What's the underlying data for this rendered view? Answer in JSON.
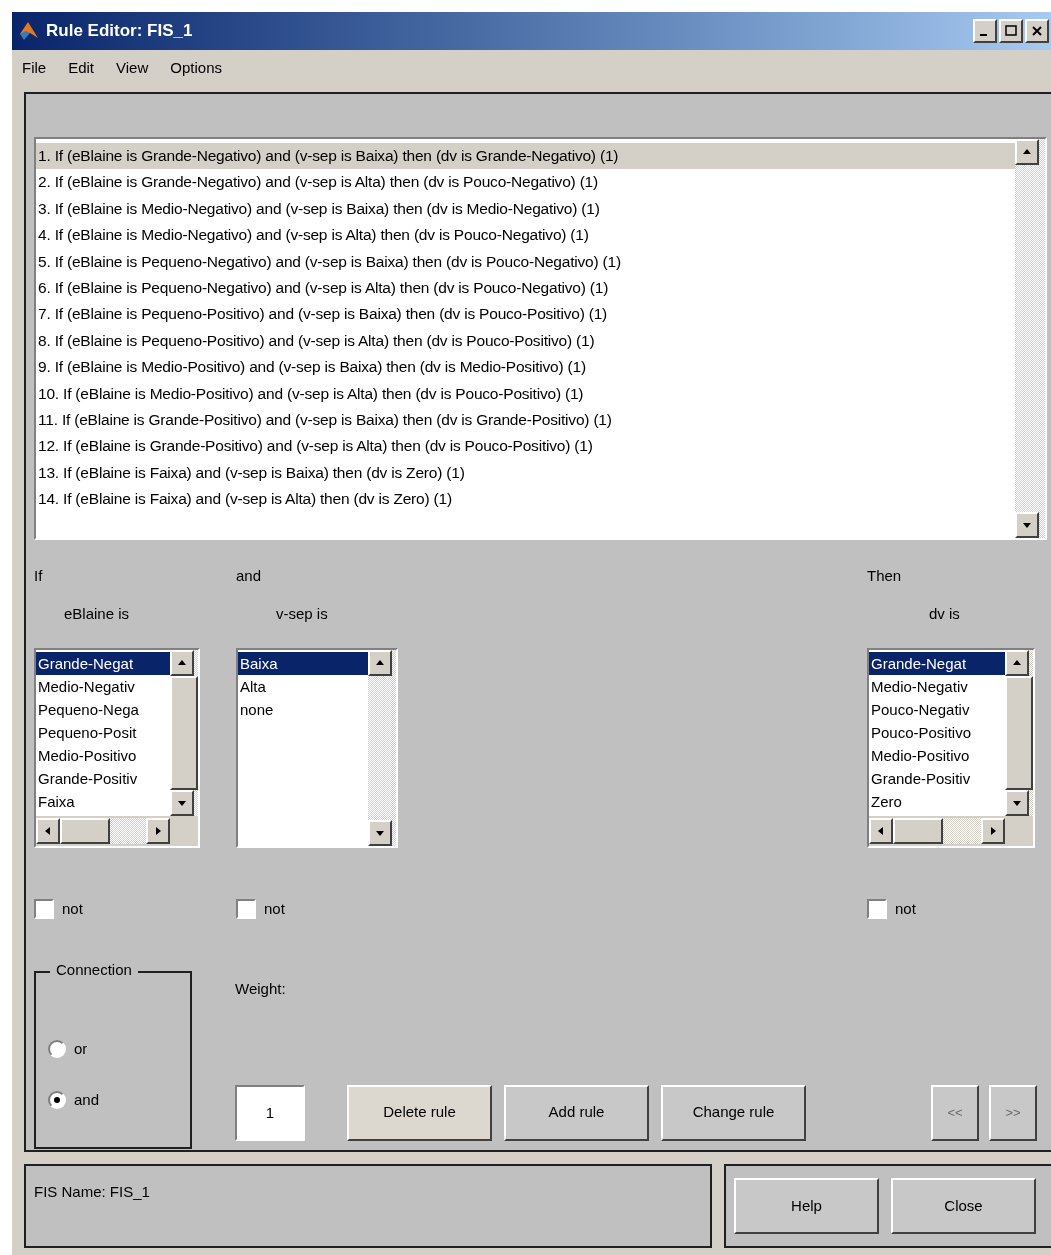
{
  "window": {
    "title": "Rule Editor: FIS_1"
  },
  "menu": [
    "File",
    "Edit",
    "View",
    "Options"
  ],
  "rules": [
    {
      "text": "1. If (eBlaine is Grande-Negativo) and (v-sep is Baixa) then (dv is Grande-Negativo) (1)",
      "selected": true
    },
    {
      "text": "2. If (eBlaine is Grande-Negativo) and (v-sep is Alta) then (dv is Pouco-Negativo) (1)",
      "selected": false
    },
    {
      "text": "3. If (eBlaine is Medio-Negativo) and (v-sep is Baixa) then (dv is Medio-Negativo) (1)",
      "selected": false
    },
    {
      "text": "4. If (eBlaine is Medio-Negativo) and (v-sep is Alta) then (dv is Pouco-Negativo) (1)",
      "selected": false
    },
    {
      "text": "5. If (eBlaine is Pequeno-Negativo) and (v-sep is Baixa) then (dv is Pouco-Negativo) (1)",
      "selected": false
    },
    {
      "text": "6. If (eBlaine is Pequeno-Negativo) and (v-sep is Alta) then (dv is Pouco-Negativo) (1)",
      "selected": false
    },
    {
      "text": "7. If (eBlaine is Pequeno-Positivo) and (v-sep is Baixa) then (dv is Pouco-Positivo) (1)",
      "selected": false
    },
    {
      "text": "8. If (eBlaine is Pequeno-Positivo) and (v-sep is Alta) then (dv is Pouco-Positivo) (1)",
      "selected": false
    },
    {
      "text": "9. If (eBlaine is Medio-Positivo) and (v-sep is Baixa) then (dv is Medio-Positivo) (1)",
      "selected": false
    },
    {
      "text": "10. If (eBlaine is Medio-Positivo) and (v-sep is Alta) then (dv is Pouco-Positivo) (1)",
      "selected": false
    },
    {
      "text": "11. If (eBlaine is Grande-Positivo) and (v-sep is Baixa) then (dv is Grande-Positivo) (1)",
      "selected": false
    },
    {
      "text": "12. If (eBlaine is Grande-Positivo) and (v-sep is Alta) then (dv is Pouco-Positivo) (1)",
      "selected": false
    },
    {
      "text": "13. If (eBlaine is Faixa) and (v-sep is Baixa) then (dv is Zero) (1)",
      "selected": false
    },
    {
      "text": "14. If (eBlaine is Faixa) and (v-sep is Alta) then (dv is Zero) (1)",
      "selected": false
    }
  ],
  "if_label": "If",
  "and_label": "and",
  "then_label": "Then",
  "inputs": [
    {
      "label": "eBlaine is",
      "horizontal_scroll": true,
      "items": [
        {
          "text": "Grande-Negat",
          "selected": true
        },
        {
          "text": "Medio-Negativ",
          "selected": false
        },
        {
          "text": "Pequeno-Nega",
          "selected": false
        },
        {
          "text": "Pequeno-Posit",
          "selected": false
        },
        {
          "text": "Medio-Positivo",
          "selected": false
        },
        {
          "text": "Grande-Positiv",
          "selected": false
        },
        {
          "text": "Faixa",
          "selected": false
        }
      ],
      "not": {
        "label": "not",
        "checked": false
      }
    },
    {
      "label": "v-sep is",
      "horizontal_scroll": false,
      "items": [
        {
          "text": "Baixa",
          "selected": true
        },
        {
          "text": "Alta",
          "selected": false
        },
        {
          "text": "none",
          "selected": false
        }
      ],
      "not": {
        "label": "not",
        "checked": false
      }
    }
  ],
  "output": {
    "label": "dv is",
    "horizontal_scroll": true,
    "items": [
      {
        "text": "Grande-Negat",
        "selected": true
      },
      {
        "text": "Medio-Negativ",
        "selected": false
      },
      {
        "text": "Pouco-Negativ",
        "selected": false
      },
      {
        "text": "Pouco-Positivo",
        "selected": false
      },
      {
        "text": "Medio-Positivo",
        "selected": false
      },
      {
        "text": "Grande-Positiv",
        "selected": false
      },
      {
        "text": "Zero",
        "selected": false
      }
    ],
    "not": {
      "label": "not",
      "checked": false
    }
  },
  "connection": {
    "title": "Connection",
    "options": [
      {
        "label": "or",
        "selected": false
      },
      {
        "label": "and",
        "selected": true
      }
    ]
  },
  "weight": {
    "label": "Weight:",
    "value": "1"
  },
  "buttons": [
    {
      "label": "Delete rule",
      "focused": true
    },
    {
      "label": "Add rule",
      "focused": false
    },
    {
      "label": "Change rule",
      "focused": false
    }
  ],
  "nav_buttons": [
    {
      "label": "<<",
      "disabled": true
    },
    {
      "label": ">>",
      "disabled": true
    }
  ],
  "status": "FIS Name: FIS_1",
  "footer_buttons": [
    "Help",
    "Close"
  ]
}
